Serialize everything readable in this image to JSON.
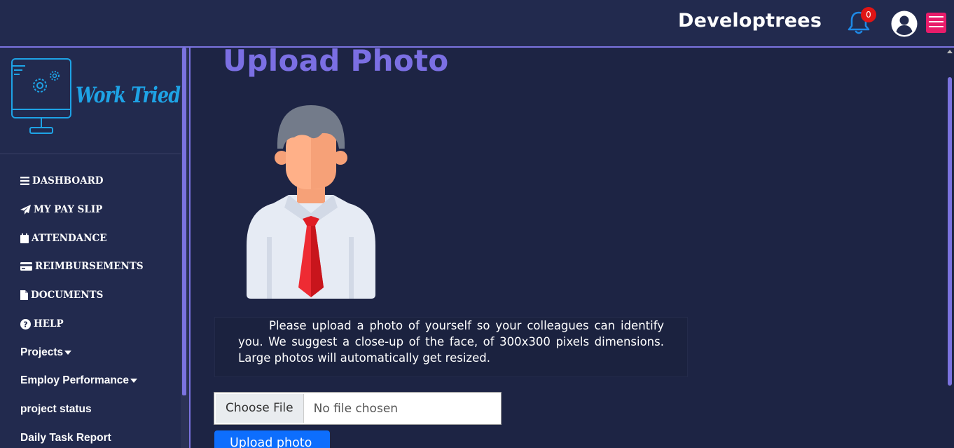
{
  "header": {
    "brand": "Developtrees",
    "notification_count": "0"
  },
  "sidebar": {
    "logo_text": "Work Tried",
    "items": [
      {
        "label": "DASHBOARD",
        "icon": "bars-icon"
      },
      {
        "label": "MY PAY SLIP",
        "icon": "paper-plane-icon"
      },
      {
        "label": "ATTENDANCE",
        "icon": "calendar-icon"
      },
      {
        "label": "REIMBURSEMENTS",
        "icon": "credit-card-icon"
      },
      {
        "label": "DOCUMENTS",
        "icon": "file-icon"
      },
      {
        "label": "HELP",
        "icon": "question-circle-icon"
      },
      {
        "label": "Projects"
      },
      {
        "label": "Employ Performance"
      },
      {
        "label": "project status"
      },
      {
        "label": "Daily Task Report"
      }
    ]
  },
  "main": {
    "title": "Upload Photo",
    "instructions": "Please upload a photo of yourself so your colleagues can identify you. We suggest a close-up of the face, of 300x300 pixels dimensions. Large photos will automatically get resized.",
    "file_button": "Choose File",
    "file_status": "No file chosen",
    "upload_button": "Upload photo"
  },
  "colors": {
    "background": "#1d2444",
    "topbar": "#222a4e",
    "accent": "#7b73e0",
    "title": "#7b6fe3",
    "upload_button": "#0d6efd",
    "menu_button": "#e81c6a",
    "badge": "#e01515"
  }
}
